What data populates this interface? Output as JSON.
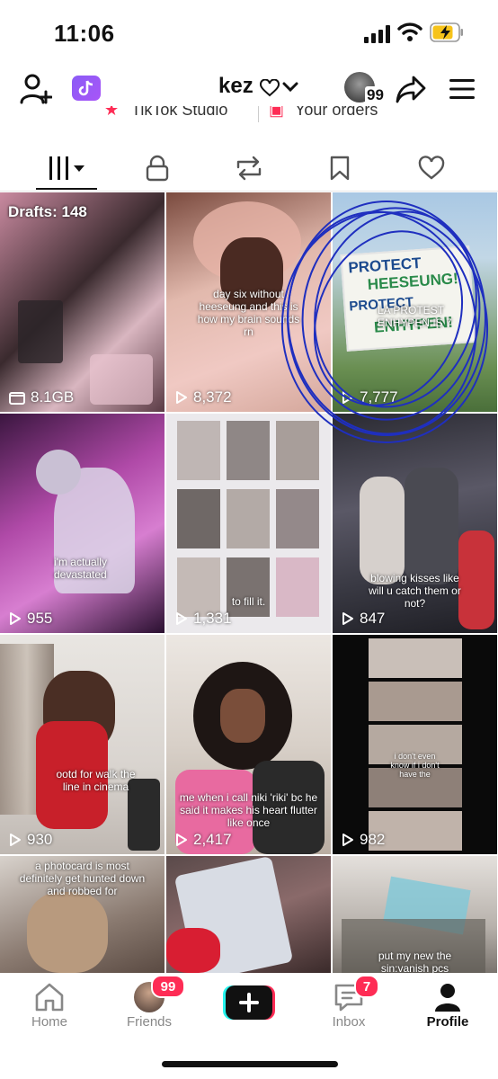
{
  "status_bar": {
    "time": "11:06"
  },
  "header": {
    "username": "kez",
    "friends_count": "99"
  },
  "peek_row": {
    "studio": "TikTok Studio",
    "orders": "Your orders"
  },
  "colors": {
    "accent": "#fe2c55",
    "studio": "#a855f7",
    "scribble": "#1f2fbf"
  },
  "grid": {
    "tiles": [
      {
        "drafts_label": "Drafts: 148",
        "size": "8.1GB",
        "caption": ""
      },
      {
        "views": "8,372",
        "caption": "day six without heeseung and this is how my brain sounds rn"
      },
      {
        "views": "7,777",
        "caption": "LA PROTEST ENHYPEN IS 7",
        "sign": [
          "PROTECT",
          "HEESEUNG!",
          "PROTECT",
          "ENHYPEN!"
        ]
      },
      {
        "views": "955",
        "caption": "i'm actually devastated"
      },
      {
        "views": "1,331",
        "caption": "to fill it."
      },
      {
        "views": "847",
        "caption": "blowing kisses like will u catch them or not?"
      },
      {
        "views": "930",
        "caption": "ootd for walk the line in cinema"
      },
      {
        "views": "2,417",
        "caption": "me when i call niki 'riki' bc he said it makes his heart flutter like once"
      },
      {
        "views": "982",
        "caption": "i don't even know if i don't have the"
      },
      {
        "views": "",
        "caption": "a photocard is most definitely get hunted down and robbed for"
      },
      {
        "views": "",
        "caption": ""
      },
      {
        "views": "",
        "caption": "put my new the sin:vanish pcs"
      }
    ]
  },
  "nav": {
    "home": "Home",
    "friends": "Friends",
    "friends_badge": "99",
    "inbox": "Inbox",
    "inbox_badge": "7",
    "profile": "Profile"
  }
}
